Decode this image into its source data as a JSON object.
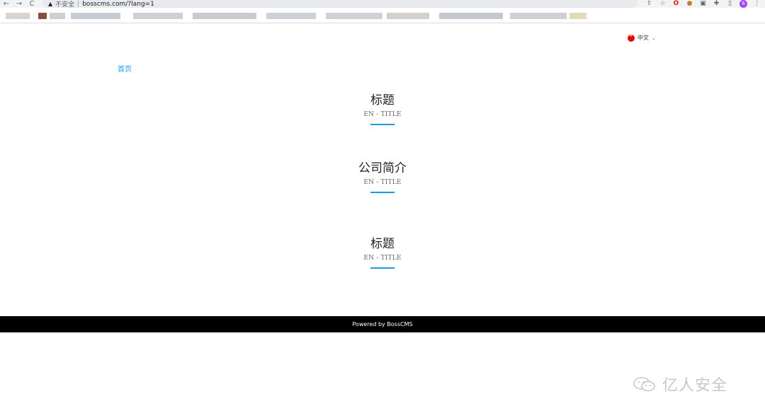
{
  "browser": {
    "nav_back": "←",
    "nav_forward": "→",
    "nav_reload": "C",
    "security_warning": "▲",
    "security_label": "不安全",
    "url_separator": "|",
    "url": "bosscms.com/?lang=1",
    "icons": [
      "share-icon",
      "star-icon",
      "opera-icon",
      "extension-icon",
      "puzzle-icon",
      "sidebar-icon",
      "profile-avatar",
      "menu-icon"
    ]
  },
  "header": {
    "language": "中文"
  },
  "breadcrumb": {
    "home": "首页"
  },
  "sections": [
    {
      "title": "标题",
      "subtitle": "EN - TITLE"
    },
    {
      "title": "公司简介",
      "subtitle": "EN - TITLE"
    },
    {
      "title": "标题",
      "subtitle": "EN - TITLE"
    }
  ],
  "footer": {
    "powered": "Powered by BossCMS"
  },
  "watermark": {
    "text": "亿人安全"
  },
  "colors": {
    "accent": "#1a9be6",
    "footer_bg": "#000000"
  }
}
